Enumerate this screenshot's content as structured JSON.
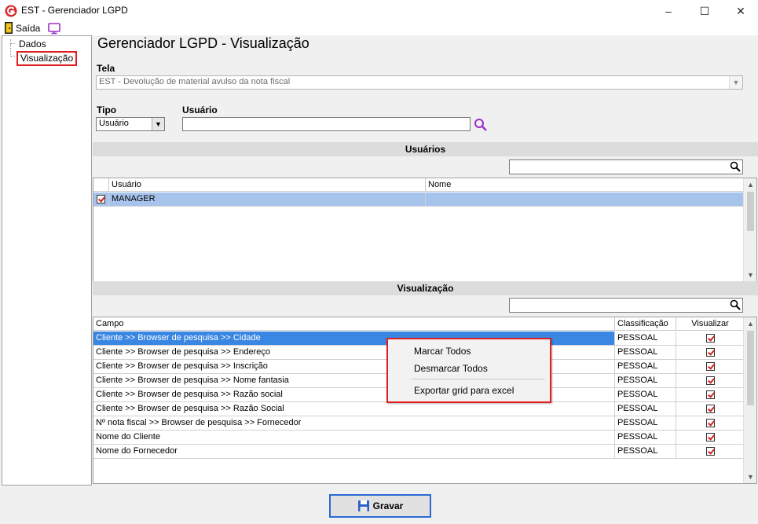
{
  "window": {
    "title": "EST - Gerenciador LGPD",
    "minimize": "–",
    "maximize": "☐",
    "close": "✕"
  },
  "menubar": {
    "exit_label": "Saída"
  },
  "tree": {
    "items": [
      {
        "label": "Dados"
      },
      {
        "label": "Visualização",
        "selected": true
      }
    ]
  },
  "page": {
    "title": "Gerenciador LGPD - Visualização"
  },
  "form": {
    "tela_label": "Tela",
    "tela_value": "EST - Devolução de material avulso da nota fiscal",
    "tipo_label": "Tipo",
    "tipo_value": "Usuário",
    "usuario_label": "Usuário",
    "usuario_value": ""
  },
  "users_section": {
    "header": "Usuários",
    "columns": [
      "Usuário",
      "Nome"
    ],
    "rows": [
      {
        "usuario": "MANAGER",
        "nome": "",
        "checked": true
      }
    ]
  },
  "vis_section": {
    "header": "Visualização",
    "columns": [
      "Campo",
      "Classificação",
      "Visualizar"
    ],
    "rows": [
      {
        "campo": "Cliente >> Browser de pesquisa >> Cidade",
        "classificacao": "PESSOAL",
        "visualizar": true
      },
      {
        "campo": "Cliente >> Browser de pesquisa >> Endereço",
        "classificacao": "PESSOAL",
        "visualizar": true
      },
      {
        "campo": "Cliente >> Browser de pesquisa >> Inscrição",
        "classificacao": "PESSOAL",
        "visualizar": true
      },
      {
        "campo": "Cliente >> Browser de pesquisa >> Nome fantasia",
        "classificacao": "PESSOAL",
        "visualizar": true
      },
      {
        "campo": "Cliente >> Browser de pesquisa >> Razão social",
        "classificacao": "PESSOAL",
        "visualizar": true
      },
      {
        "campo": "Cliente >> Browser de pesquisa >> Razão Social",
        "classificacao": "PESSOAL",
        "visualizar": true
      },
      {
        "campo": "Nº nota fiscal >> Browser de pesquisa >> Fornecedor",
        "classificacao": "PESSOAL",
        "visualizar": true
      },
      {
        "campo": "Nome do Cliente",
        "classificacao": "PESSOAL",
        "visualizar": true
      },
      {
        "campo": "Nome do Fornecedor",
        "classificacao": "PESSOAL",
        "visualizar": true
      }
    ]
  },
  "context_menu": {
    "items": [
      "Marcar Todos",
      "Desmarcar Todos",
      "Exportar grid para excel"
    ]
  },
  "footer": {
    "save_label": "Gravar"
  },
  "colors": {
    "selection": "#3a86e3",
    "highlight_border": "#e02020",
    "check_mark": "#d02020"
  }
}
